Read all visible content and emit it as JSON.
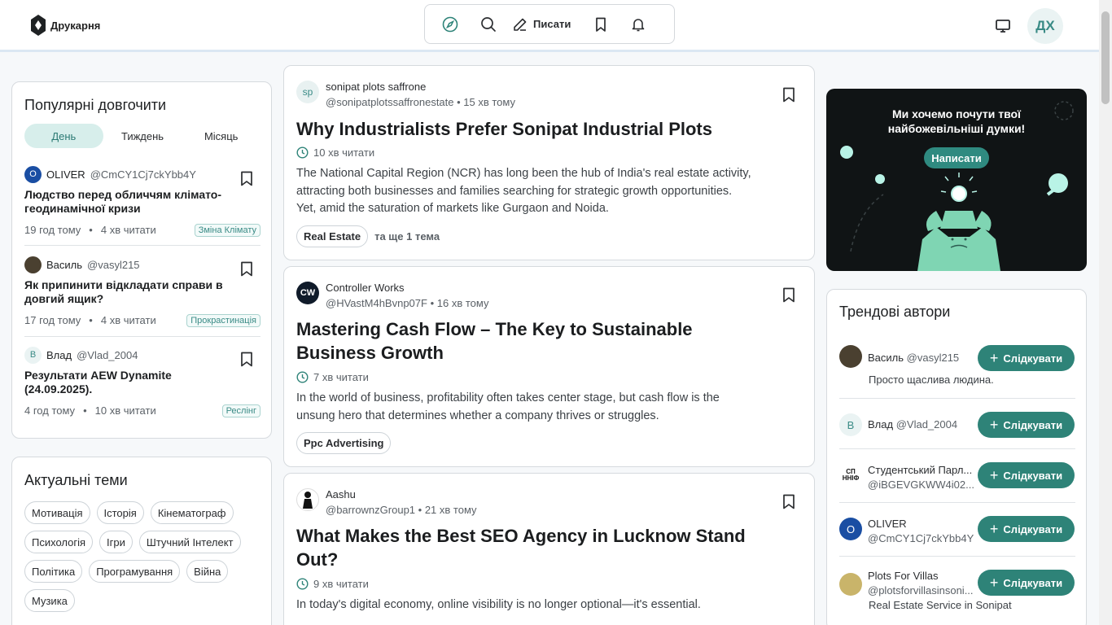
{
  "header": {
    "logo_text": "Друкарня",
    "write_label": "Писати",
    "avatar_initials": "ДХ"
  },
  "popular": {
    "title": "Популярні довгочити",
    "tabs": [
      "День",
      "Тиждень",
      "Місяць"
    ],
    "active_tab": "День",
    "items": [
      {
        "avatar": "O",
        "name": "OLIVER",
        "handle": "@CmCY1Cj7ckYbb4Y",
        "title": "Людство перед обличчям клімато-геодинамічної кризи",
        "time": "19 год тому",
        "read": "4 хв читати",
        "tag": "Зміна Клімату"
      },
      {
        "avatar": "",
        "name": "Василь",
        "handle": "@vasyl215",
        "title": "Як припинити відкладати справи в довгий ящик?",
        "time": "17 год тому",
        "read": "4 хв читати",
        "tag": "Прокрастинація"
      },
      {
        "avatar": "B",
        "name": "Влад",
        "handle": "@Vlad_2004",
        "title": "Результати AEW Dynamite (24.09.2025).",
        "time": "4 год тому",
        "read": "10 хв читати",
        "tag": "Реслінг"
      }
    ]
  },
  "topics": {
    "title": "Актуальні теми",
    "items": [
      "Мотивація",
      "Історія",
      "Кінематограф",
      "Психологія",
      "Ігри",
      "Штучний Інтелект",
      "Політика",
      "Програмування",
      "Війна",
      "Музика"
    ]
  },
  "feed": [
    {
      "avatar": "sp",
      "author": "sonipat plots saffrone",
      "handle": "@sonipatplotssaffronestate",
      "time": "15 хв тому",
      "title": "Why Industrialists Prefer Sonipat Industrial Plots",
      "read": "10 хв читати",
      "excerpt": "The National Capital Region (NCR) has long been the hub of India's real estate activity, attracting both businesses and families searching for strategic growth opportunities. Yet, amid the saturation of markets like Gurgaon and Noida.",
      "tag": "Real Estate",
      "more": "та ще 1 тема"
    },
    {
      "avatar": "CW",
      "author": "Controller Works",
      "handle": "@HVastM4hBvnp07F",
      "time": "16 хв тому",
      "title": "Mastering Cash Flow – The Key to Sustainable Business Growth",
      "read": "7 хв читати",
      "excerpt": "In the world of business, profitability often takes center stage, but cash flow is the unsung hero that determines whether a company thrives or struggles.",
      "tag": "Ppc Advertising",
      "more": ""
    },
    {
      "avatar": "",
      "author": "Aashu",
      "handle": "@barrownzGroup1",
      "time": "21 хв тому",
      "title": "What Makes the Best SEO Agency in Lucknow Stand Out?",
      "read": "9 хв читати",
      "excerpt": "In today's digital economy, online visibility is no longer optional—it's essential.",
      "tag": "",
      "more": ""
    }
  ],
  "banner": {
    "text_line1": "Ми хочемо почути твої",
    "text_line2": "найбожевільніші думки!",
    "button": "Написати"
  },
  "trending": {
    "title": "Трендові автори",
    "follow_label": "Слідкувати",
    "authors": [
      {
        "avatar": "",
        "name": "Василь",
        "handle": "@vasyl215",
        "bio": "Просто щаслива людина."
      },
      {
        "avatar": "B",
        "name": "Влад",
        "handle": "@Vlad_2004",
        "bio": ""
      },
      {
        "avatar": "СП ННІФ",
        "name": "Студентський Парл...",
        "handle": "@iBGEVGKWW4i02...",
        "bio": ""
      },
      {
        "avatar": "O",
        "name": "OLIVER",
        "handle": "@CmCY1Cj7ckYbb4Y",
        "bio": ""
      },
      {
        "avatar": "",
        "name": "Plots For Villas",
        "handle": "@plotsforvillasinsoni...",
        "bio": "Real Estate Service in Sonipat"
      }
    ]
  },
  "colors": {
    "accent": "#2e8378",
    "accent_light": "#d7eeeb",
    "banner_bg": "#101415"
  }
}
